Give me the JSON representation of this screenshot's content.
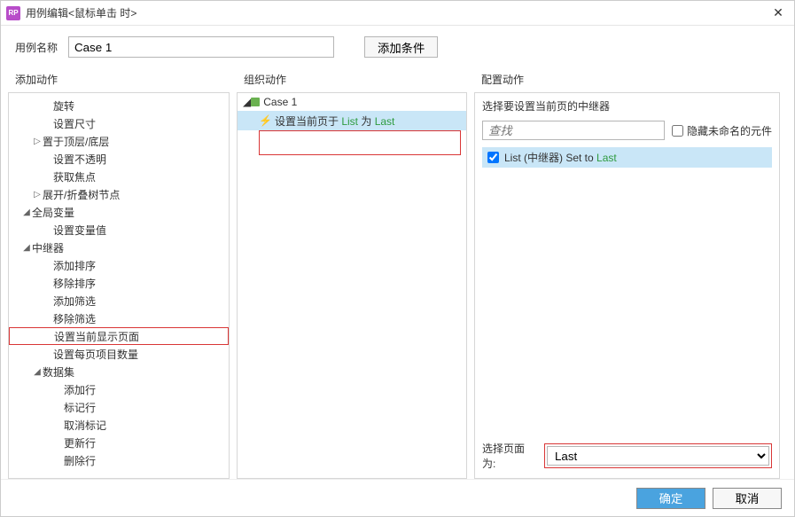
{
  "titlebar": {
    "title": "用例编辑<鼠标单击 时>"
  },
  "namerow": {
    "label": "用例名称",
    "value": "Case 1",
    "addcond": "添加条件"
  },
  "cols": {
    "c1": "添加动作",
    "c2": "组织动作",
    "c3": "配置动作"
  },
  "tree": [
    {
      "indent": 38,
      "caret": "",
      "label": "旋转"
    },
    {
      "indent": 38,
      "caret": "",
      "label": "设置尺寸"
    },
    {
      "indent": 26,
      "caret": "▷",
      "label": "置于顶层/底层"
    },
    {
      "indent": 38,
      "caret": "",
      "label": "设置不透明"
    },
    {
      "indent": 38,
      "caret": "",
      "label": "获取焦点"
    },
    {
      "indent": 26,
      "caret": "▷",
      "label": "展开/折叠树节点"
    },
    {
      "indent": 14,
      "caret": "◢",
      "label": "全局变量"
    },
    {
      "indent": 38,
      "caret": "",
      "label": "设置变量值"
    },
    {
      "indent": 14,
      "caret": "◢",
      "label": "中继器"
    },
    {
      "indent": 38,
      "caret": "",
      "label": "添加排序"
    },
    {
      "indent": 38,
      "caret": "",
      "label": "移除排序"
    },
    {
      "indent": 38,
      "caret": "",
      "label": "添加筛选"
    },
    {
      "indent": 38,
      "caret": "",
      "label": "移除筛选"
    },
    {
      "indent": 38,
      "caret": "",
      "label": "设置当前显示页面",
      "hl": true
    },
    {
      "indent": 38,
      "caret": "",
      "label": "设置每页项目数量"
    },
    {
      "indent": 26,
      "caret": "◢",
      "label": "数据集"
    },
    {
      "indent": 50,
      "caret": "",
      "label": "添加行"
    },
    {
      "indent": 50,
      "caret": "",
      "label": "标记行"
    },
    {
      "indent": 50,
      "caret": "",
      "label": "取消标记"
    },
    {
      "indent": 50,
      "caret": "",
      "label": "更新行"
    },
    {
      "indent": 50,
      "caret": "",
      "label": "删除行"
    }
  ],
  "org": {
    "case": "Case 1",
    "action_prefix": "设置当前页于 ",
    "action_link": "List",
    "action_mid": " 为 ",
    "action_val": "Last"
  },
  "cfg": {
    "heading": "选择要设置当前页的中继器",
    "search_placeholder": "查找",
    "hide_label": "隐藏未命名的元件",
    "item_prefix": "List (中继器) Set to ",
    "item_val": "Last",
    "select_label": "选择页面为:",
    "select_value": "Last"
  },
  "footer": {
    "ok": "确定",
    "cancel": "取消"
  }
}
